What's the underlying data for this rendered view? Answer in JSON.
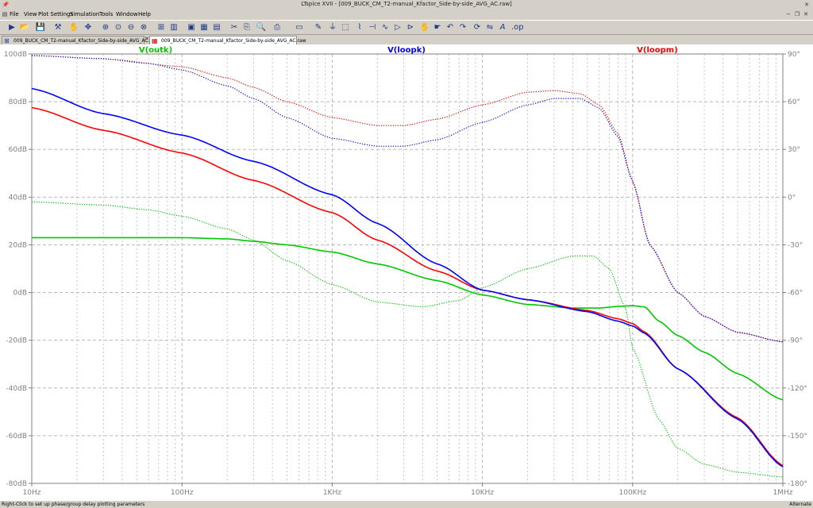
{
  "window": {
    "title": "LTspice XVII - [009_BUCK_CM_T2-manual_Kfactor_Side-by-side_AVG_AC.raw]"
  },
  "menu": [
    "File",
    "View",
    "Plot Settings",
    "Simulation",
    "Tools",
    "Window",
    "Help"
  ],
  "tabs": [
    {
      "label": "009_BUCK_CM_T2-manual_Kfactor_Side-by-side_AVG_AC.asc",
      "active": false
    },
    {
      "label": "009_BUCK_CM_T2-manual_Kfactor_Side-by-side_AVG_AC.raw",
      "active": true
    }
  ],
  "toolbar_icons": [
    "run-icon",
    "open-icon",
    "save-icon",
    "control-panel-icon",
    "halt-icon",
    "pan-icon",
    "zoom-in-icon",
    "zoom-full-icon",
    "zoom-out-icon",
    "zoom-cancel-icon",
    "autorange-icon",
    "tile-icon",
    "cascade-icon",
    "close-icon",
    "cut-icon",
    "copy-icon",
    "paste-icon",
    "find-icon",
    "print-icon",
    "draw-wire-icon",
    "ground-icon",
    "label-icon",
    "resistor-icon",
    "capacitor-icon",
    "inductor-icon",
    "diode-icon",
    "component-icon",
    "move-icon",
    "drag-icon",
    "undo-icon",
    "redo-icon",
    "rotate-icon",
    "mirror-icon",
    "text-icon",
    "spice-directive-icon"
  ],
  "status": {
    "left": "Right-Click to set up phase/group delay plotting parameters",
    "right": "Alternate"
  },
  "colors": {
    "outk": "#00c800",
    "loopk": "#0000ff",
    "loopm": "#ff0000",
    "grid": "#b8b8b8",
    "axis_text": "#808080"
  },
  "chart_data": {
    "type": "line",
    "x_scale": "log",
    "xlim": [
      10,
      1000000
    ],
    "xticks": [
      "10Hz",
      "100Hz",
      "1KHz",
      "10KHz",
      "100KHz",
      "1MHz"
    ],
    "ylim": [
      -80,
      100
    ],
    "yticks_left": [
      "100dB",
      "80dB",
      "60dB",
      "40dB",
      "20dB",
      "0dB",
      "-20dB",
      "-40dB",
      "-60dB",
      "-80dB"
    ],
    "y2lim": [
      -180,
      90
    ],
    "yticks_right": [
      "90°",
      "60°",
      "30°",
      "0°",
      "-30°",
      "-60°",
      "-90°",
      "-120°",
      "-150°",
      "-180°"
    ],
    "grid": true,
    "legend_position": "top",
    "series": [
      {
        "name": "V(outk)",
        "color": "#00c800",
        "magnitude_db": [
          [
            10,
            23
          ],
          [
            30,
            23
          ],
          [
            100,
            23
          ],
          [
            200,
            22.5
          ],
          [
            300,
            21.5
          ],
          [
            500,
            20
          ],
          [
            1000,
            17
          ],
          [
            2000,
            12
          ],
          [
            5000,
            5
          ],
          [
            10000,
            -1
          ],
          [
            20000,
            -5
          ],
          [
            40000,
            -6.5
          ],
          [
            60000,
            -6.5
          ],
          [
            80000,
            -5.8
          ],
          [
            100000,
            -5.5
          ],
          [
            120000,
            -6
          ],
          [
            150000,
            -12
          ],
          [
            200000,
            -18
          ],
          [
            300000,
            -25
          ],
          [
            500000,
            -34
          ],
          [
            1000000,
            -45
          ]
        ],
        "phase_deg": [
          [
            10,
            -3
          ],
          [
            30,
            -5
          ],
          [
            60,
            -8
          ],
          [
            100,
            -12
          ],
          [
            200,
            -20
          ],
          [
            300,
            -27
          ],
          [
            500,
            -40
          ],
          [
            1000,
            -55
          ],
          [
            2000,
            -66
          ],
          [
            4000,
            -69
          ],
          [
            7000,
            -65
          ],
          [
            10000,
            -57
          ],
          [
            20000,
            -45
          ],
          [
            40000,
            -37
          ],
          [
            55000,
            -37
          ],
          [
            70000,
            -45
          ],
          [
            90000,
            -70
          ],
          [
            100000,
            -95
          ],
          [
            150000,
            -140
          ],
          [
            200000,
            -158
          ],
          [
            300000,
            -168
          ],
          [
            500000,
            -173
          ],
          [
            1000000,
            -176
          ]
        ]
      },
      {
        "name": "V(loopk)",
        "color": "#0000ff",
        "magnitude_db": [
          [
            10,
            85.5
          ],
          [
            30,
            75
          ],
          [
            100,
            66
          ],
          [
            300,
            55
          ],
          [
            1000,
            41
          ],
          [
            2000,
            29
          ],
          [
            5000,
            12
          ],
          [
            10000,
            1
          ],
          [
            20000,
            -3
          ],
          [
            50000,
            -8
          ],
          [
            80000,
            -12
          ],
          [
            100000,
            -14
          ],
          [
            120000,
            -17
          ],
          [
            200000,
            -32
          ],
          [
            500000,
            -53
          ],
          [
            1000000,
            -73
          ]
        ],
        "phase_deg": [
          [
            10,
            89
          ],
          [
            30,
            87
          ],
          [
            60,
            84
          ],
          [
            100,
            80
          ],
          [
            200,
            70
          ],
          [
            300,
            62
          ],
          [
            500,
            50
          ],
          [
            1000,
            37
          ],
          [
            2000,
            32
          ],
          [
            3000,
            32
          ],
          [
            5000,
            36
          ],
          [
            10000,
            47
          ],
          [
            20000,
            58
          ],
          [
            30000,
            62
          ],
          [
            45000,
            62
          ],
          [
            60000,
            56
          ],
          [
            80000,
            38
          ],
          [
            100000,
            10
          ],
          [
            130000,
            -30
          ],
          [
            200000,
            -60
          ],
          [
            300000,
            -75
          ],
          [
            500000,
            -85
          ],
          [
            1000000,
            -91
          ]
        ]
      },
      {
        "name": "V(loopm)",
        "color": "#ff0000",
        "magnitude_db": [
          [
            10,
            77.5
          ],
          [
            30,
            68
          ],
          [
            100,
            58.5
          ],
          [
            300,
            47
          ],
          [
            1000,
            33.5
          ],
          [
            2000,
            22
          ],
          [
            5000,
            9
          ],
          [
            10000,
            1
          ],
          [
            20000,
            -3
          ],
          [
            50000,
            -7.5
          ],
          [
            80000,
            -11
          ],
          [
            100000,
            -13
          ],
          [
            120000,
            -16.5
          ],
          [
            200000,
            -32
          ],
          [
            500000,
            -52.5
          ],
          [
            1000000,
            -72.5
          ]
        ],
        "phase_deg": [
          [
            10,
            89
          ],
          [
            30,
            87
          ],
          [
            100,
            82
          ],
          [
            200,
            75
          ],
          [
            300,
            69
          ],
          [
            500,
            60
          ],
          [
            1000,
            50
          ],
          [
            2000,
            45
          ],
          [
            3000,
            45
          ],
          [
            5000,
            49
          ],
          [
            10000,
            58
          ],
          [
            20000,
            66
          ],
          [
            30000,
            67
          ],
          [
            45000,
            65
          ],
          [
            60000,
            58
          ],
          [
            80000,
            40
          ],
          [
            100000,
            10
          ],
          [
            130000,
            -30
          ],
          [
            200000,
            -60
          ],
          [
            300000,
            -75
          ],
          [
            500000,
            -85
          ],
          [
            1000000,
            -91
          ]
        ]
      }
    ]
  }
}
